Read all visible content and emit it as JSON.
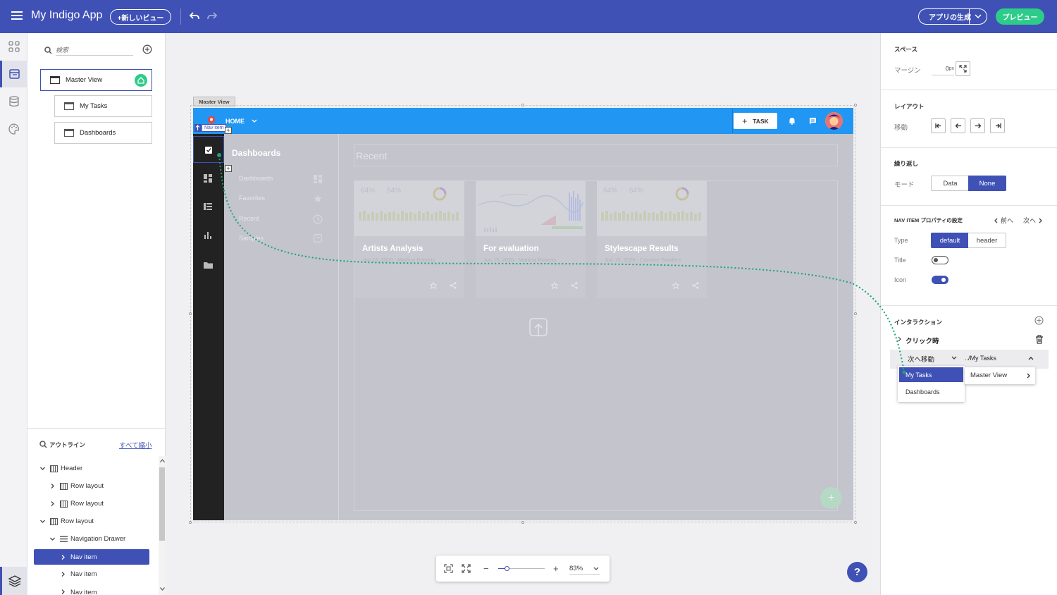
{
  "app": {
    "title": "My Indigo App",
    "new_view": "+新しいビュー",
    "generate": "アプリの生成",
    "preview": "プレビュー"
  },
  "views": {
    "search_placeholder": "検索",
    "items": [
      {
        "label": "Master View"
      },
      {
        "label": "My Tasks"
      },
      {
        "label": "Dashboards"
      }
    ]
  },
  "outline": {
    "title": "アウトライン",
    "collapse_all": "すべて縮小",
    "rows": [
      {
        "label": "Header"
      },
      {
        "label": "Row layout"
      },
      {
        "label": "Row layout"
      },
      {
        "label": "Row layout"
      },
      {
        "label": "Navigation Drawer"
      },
      {
        "label": "Nav item"
      },
      {
        "label": "Nav item"
      },
      {
        "label": "Nav item"
      }
    ]
  },
  "design": {
    "frame_tag": "Master View",
    "header": {
      "home": "HOME",
      "task_button": "TASK"
    },
    "nav_tag": "Nav item",
    "drawer": {
      "title": "Dashboards",
      "items": [
        {
          "label": "Dashboards"
        },
        {
          "label": "Favorites"
        },
        {
          "label": "Recent"
        },
        {
          "label": "Samples"
        }
      ]
    },
    "recent_title": "Recent",
    "cards": [
      {
        "title": "Artists Analysis",
        "subtitle": "Jun 15, 2020 - Martina Roberts",
        "stat_a": "64%",
        "stat_b": "54%"
      },
      {
        "title": "For evaluation",
        "subtitle": "Jun 15, 2020 - Martina Roberts",
        "stat_a": "",
        "stat_b": ""
      },
      {
        "title": "Stylescape Results",
        "subtitle": "Jun 15, 2020 - Caroline Sanders",
        "stat_a": "64%",
        "stat_b": "54%"
      }
    ]
  },
  "zoom": {
    "value": "83%",
    "level": 0.2
  },
  "props": {
    "space_title": "スペース",
    "margin_label": "マージン",
    "margin_value": "0",
    "margin_unit": "px",
    "layout_title": "レイアウト",
    "move_label": "移動",
    "wrap_title": "繰り返し",
    "mode_label": "モード",
    "mode_options": [
      "Data",
      "None"
    ],
    "mode_selected": "None",
    "nav_title": "NAV ITEM プロパティの設定",
    "prev": "前へ",
    "next": "次へ",
    "type_label": "Type",
    "type_options": [
      "default",
      "header"
    ],
    "type_selected": "default",
    "title_label": "Title",
    "title_on": false,
    "icon_label": "Icon",
    "icon_on": true,
    "interaction_title": "インタラクション",
    "on_click": "クリック時",
    "action": "次へ移動",
    "target": "../My Tasks",
    "menu_left": [
      "My Tasks",
      "Dashboards"
    ],
    "menu_right": [
      "Master View"
    ]
  },
  "colors": {
    "primary": "#3f51b5",
    "accent": "#2ecc8a",
    "header_blue": "#2196f3",
    "drawer_dark": "#222222"
  }
}
